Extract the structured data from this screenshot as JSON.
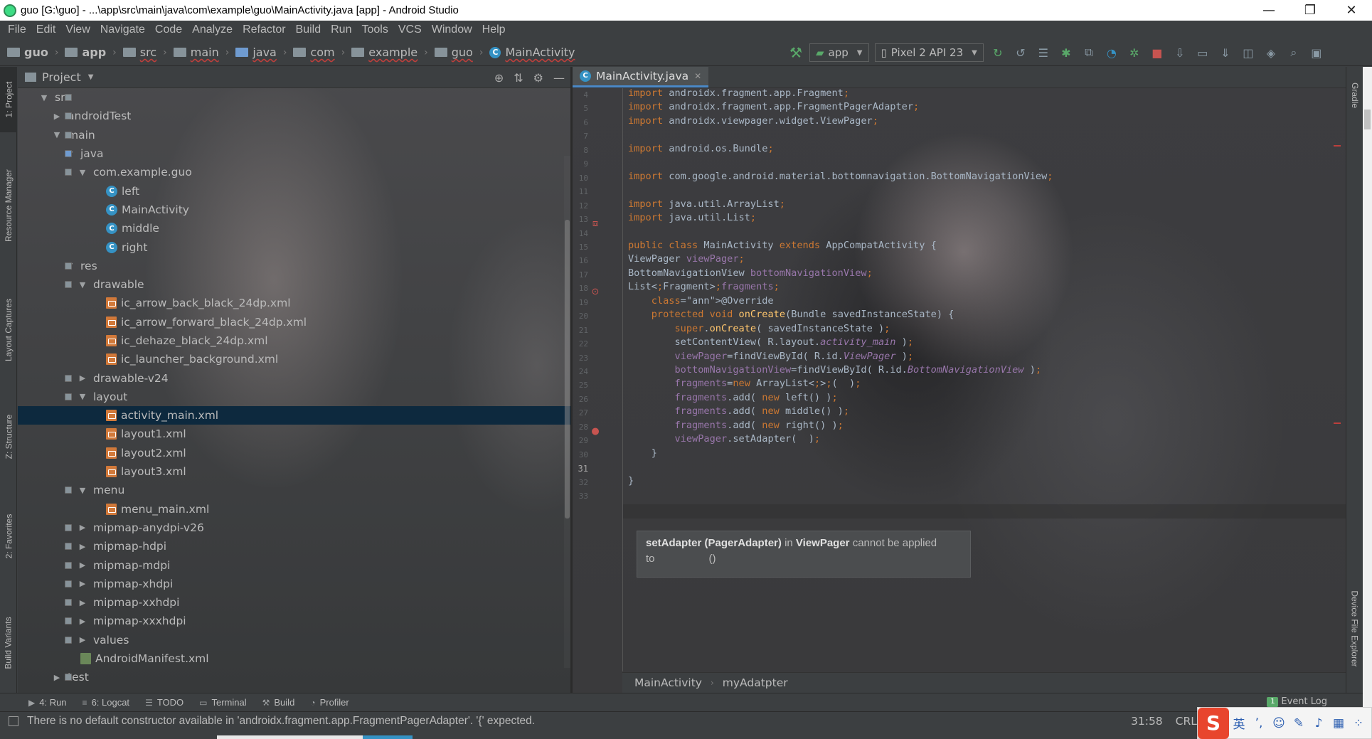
{
  "window": {
    "title": "guo [G:\\guo] - ...\\app\\src\\main\\java\\com\\example\\guo\\MainActivity.java [app] - Android Studio",
    "controls": [
      "—",
      "❐",
      "✕"
    ]
  },
  "menu": [
    "File",
    "Edit",
    "View",
    "Navigate",
    "Code",
    "Analyze",
    "Refactor",
    "Build",
    "Run",
    "Tools",
    "VCS",
    "Window",
    "Help"
  ],
  "breadcrumbs": [
    "guo",
    "app",
    "src",
    "main",
    "java",
    "com",
    "example",
    "guo",
    "MainActivity"
  ],
  "run": {
    "config": "app",
    "device": "Pixel 2 API 23"
  },
  "left_stripe": [
    "1: Project",
    "Resource Manager",
    "Layout Captures",
    "Z: Structure",
    "2: Favorites",
    "Build Variants"
  ],
  "right_stripe": [
    "Gradle",
    "Device File Explorer"
  ],
  "project": {
    "title": "Project",
    "tree": [
      {
        "label": "src",
        "depth": 2,
        "arrow": "▼",
        "icon": "fold"
      },
      {
        "label": "androidTest",
        "depth": 3,
        "arrow": "▶",
        "icon": "fold"
      },
      {
        "label": "main",
        "depth": 3,
        "arrow": "▼",
        "icon": "fold"
      },
      {
        "label": "java",
        "depth": 4,
        "arrow": "▼",
        "icon": "fold-blue"
      },
      {
        "label": "com.example.guo",
        "depth": 5,
        "arrow": "▼",
        "icon": "fold"
      },
      {
        "label": "left",
        "depth": 6,
        "arrow": "",
        "icon": "cls"
      },
      {
        "label": "MainActivity",
        "depth": 6,
        "arrow": "",
        "icon": "cls"
      },
      {
        "label": "middle",
        "depth": 6,
        "arrow": "",
        "icon": "cls"
      },
      {
        "label": "right",
        "depth": 6,
        "arrow": "",
        "icon": "cls"
      },
      {
        "label": "res",
        "depth": 4,
        "arrow": "▼",
        "icon": "fold"
      },
      {
        "label": "drawable",
        "depth": 5,
        "arrow": "▼",
        "icon": "fold"
      },
      {
        "label": "ic_arrow_back_black_24dp.xml",
        "depth": 6,
        "arrow": "",
        "icon": "xml"
      },
      {
        "label": "ic_arrow_forward_black_24dp.xml",
        "depth": 6,
        "arrow": "",
        "icon": "xml"
      },
      {
        "label": "ic_dehaze_black_24dp.xml",
        "depth": 6,
        "arrow": "",
        "icon": "xml"
      },
      {
        "label": "ic_launcher_background.xml",
        "depth": 6,
        "arrow": "",
        "icon": "xml"
      },
      {
        "label": "drawable-v24",
        "depth": 5,
        "arrow": "▶",
        "icon": "fold"
      },
      {
        "label": "layout",
        "depth": 5,
        "arrow": "▼",
        "icon": "fold"
      },
      {
        "label": "activity_main.xml",
        "depth": 6,
        "arrow": "",
        "icon": "xml",
        "selected": true
      },
      {
        "label": "layout1.xml",
        "depth": 6,
        "arrow": "",
        "icon": "xml"
      },
      {
        "label": "layout2.xml",
        "depth": 6,
        "arrow": "",
        "icon": "xml"
      },
      {
        "label": "layout3.xml",
        "depth": 6,
        "arrow": "",
        "icon": "xml"
      },
      {
        "label": "menu",
        "depth": 5,
        "arrow": "▼",
        "icon": "fold"
      },
      {
        "label": "menu_main.xml",
        "depth": 6,
        "arrow": "",
        "icon": "xml"
      },
      {
        "label": "mipmap-anydpi-v26",
        "depth": 5,
        "arrow": "▶",
        "icon": "fold"
      },
      {
        "label": "mipmap-hdpi",
        "depth": 5,
        "arrow": "▶",
        "icon": "fold"
      },
      {
        "label": "mipmap-mdpi",
        "depth": 5,
        "arrow": "▶",
        "icon": "fold"
      },
      {
        "label": "mipmap-xhdpi",
        "depth": 5,
        "arrow": "▶",
        "icon": "fold"
      },
      {
        "label": "mipmap-xxhdpi",
        "depth": 5,
        "arrow": "▶",
        "icon": "fold"
      },
      {
        "label": "mipmap-xxxhdpi",
        "depth": 5,
        "arrow": "▶",
        "icon": "fold"
      },
      {
        "label": "values",
        "depth": 5,
        "arrow": "▶",
        "icon": "fold"
      },
      {
        "label": "AndroidManifest.xml",
        "depth": 4,
        "arrow": "",
        "icon": "mf"
      },
      {
        "label": "test",
        "depth": 3,
        "arrow": "▶",
        "icon": "fold"
      }
    ]
  },
  "editor": {
    "tab": "MainActivity.java",
    "current_line": "31",
    "line_numbers": [
      "4",
      "5",
      "6",
      "7",
      "8",
      "9",
      "10",
      "11",
      "12",
      "13",
      "14",
      "15",
      "16",
      "17",
      "18",
      "19",
      "20",
      "21",
      "22",
      "23",
      "24",
      "25",
      "26",
      "27",
      "28",
      "29",
      "30",
      "31",
      "32",
      "33"
    ],
    "lines": [
      "import androidx.fragment.app.Fragment;",
      "import androidx.fragment.app.FragmentPagerAdapter;",
      "import androidx.viewpager.widget.ViewPager;",
      "",
      "import android.os.Bundle;",
      "",
      "import com.google.android.material.bottomnavigation.BottomNavigationView;",
      "",
      "import java.util.ArrayList;",
      "import java.util.List;",
      "",
      "public class MainActivity extends AppCompatActivity {",
      "ViewPager viewPager;",
      "BottomNavigationView bottomNavigationView;",
      "List<Fragment>fragments;",
      "    @Override",
      "    protected void onCreate(Bundle savedInstanceState) {",
      "        super.onCreate( savedInstanceState );",
      "        setContentView( R.layout.activity_main );",
      "        viewPager=findViewById( R.id.ViewPager );",
      "        bottomNavigationView=findViewById( R.id.BottomNavigationView );",
      "        fragments=new ArrayList<>(  );",
      "        fragments.add( new left() );",
      "        fragments.add( new middle() );",
      "        fragments.add( new right() );",
      "        viewPager.setAdapter(  );",
      "    }",
      "",
      "}",
      ""
    ],
    "tooltip": {
      "method": "setAdapter",
      "param": "(PagerAdapter)",
      "in": "in",
      "cls": "ViewPager",
      "msg": "cannot be applied",
      "to": "to",
      "args": "()"
    },
    "breadcrumb": [
      "MainActivity",
      "myAdatpter"
    ]
  },
  "bottom_tabs": [
    {
      "key": "4",
      "label": "4: Run",
      "icon": "▶"
    },
    {
      "key": "6",
      "label": "6: Logcat",
      "icon": "≡"
    },
    {
      "key": "todo",
      "label": "TODO",
      "icon": "☰"
    },
    {
      "key": "terminal",
      "label": "Terminal",
      "icon": "▭"
    },
    {
      "key": "build",
      "label": "Build",
      "icon": "⚒"
    },
    {
      "key": "profiler",
      "label": "Profiler",
      "icon": "◔"
    }
  ],
  "event_log": {
    "count": "1",
    "label": "Event Log"
  },
  "status": {
    "message": "There is no default constructor available in 'androidx.fragment.app.FragmentPagerAdapter'. '{' expected.",
    "position": "31:58",
    "line_sep": "CRLF"
  },
  "ime": {
    "logo": "S",
    "lang": "英"
  }
}
